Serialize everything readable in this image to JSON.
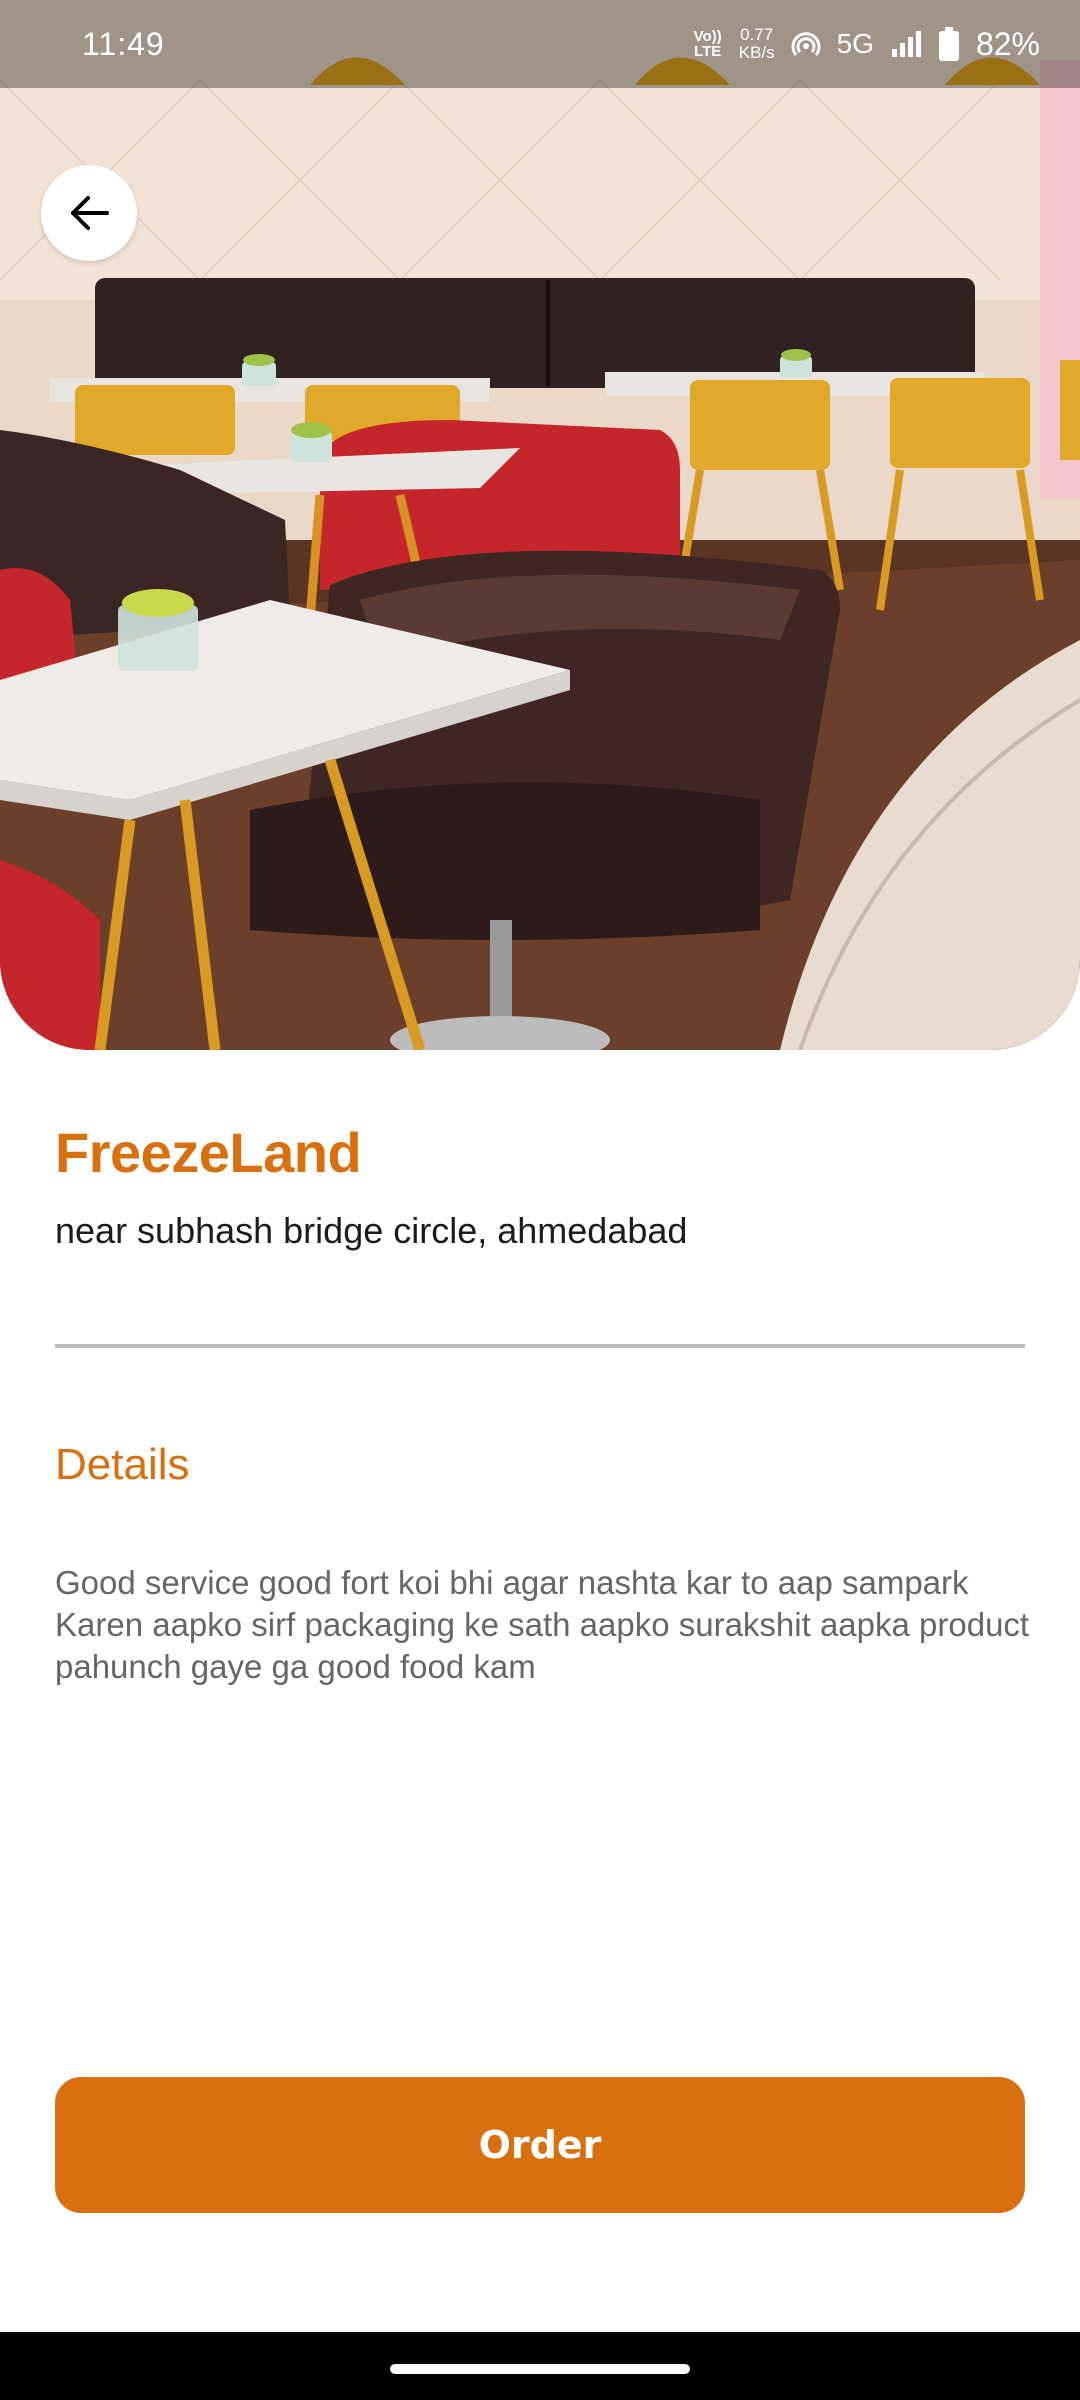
{
  "status_bar": {
    "time": "11:49",
    "lte_label_top": "Vo))",
    "lte_label_bottom": "LTE",
    "speed_value": "0.77",
    "speed_unit": "KB/s",
    "network": "5G",
    "battery": "82%",
    "icons": [
      "hotspot-icon",
      "signal-icon",
      "battery-icon"
    ]
  },
  "hero": {
    "image_description_icon": "restaurant-photo"
  },
  "back_button": {
    "icon": "arrow-left-icon"
  },
  "store": {
    "name": "FreezeLand",
    "address": "near subhash bridge circle, ahmedabad"
  },
  "details": {
    "heading": "Details",
    "text": "Good service good fort koi bhi agar nashta kar to aap sampark Karen aapko sirf packaging ke sath aapko surakshit aapka product pahunch gaye ga good food kam"
  },
  "actions": {
    "order_label": "Order"
  },
  "colors": {
    "accent": "#d8700f",
    "text_primary": "#1c1c1c",
    "text_secondary": "#666666",
    "divider": "#bdbdbd"
  }
}
